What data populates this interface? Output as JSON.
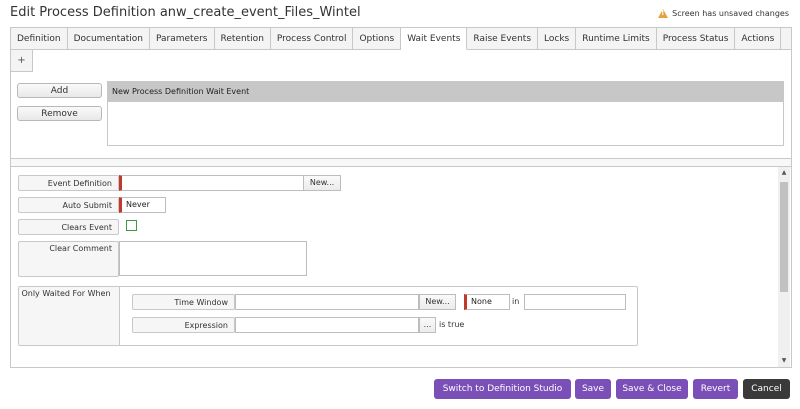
{
  "header": {
    "title": "Edit Process Definition anw_create_event_Files_Wintel",
    "unsaved_text": "Screen has unsaved changes",
    "warning_icon": "warning-triangle-icon",
    "warning_color": "#e6a23c"
  },
  "tabs": [
    {
      "label": "Definition"
    },
    {
      "label": "Documentation"
    },
    {
      "label": "Parameters"
    },
    {
      "label": "Retention"
    },
    {
      "label": "Process Control"
    },
    {
      "label": "Options"
    },
    {
      "label": "Wait Events",
      "active": true
    },
    {
      "label": "Raise Events"
    },
    {
      "label": "Locks"
    },
    {
      "label": "Runtime Limits"
    },
    {
      "label": "Process Status"
    },
    {
      "label": "Actions"
    }
  ],
  "add_tab_label": "+",
  "events_list": {
    "add_label": "Add",
    "remove_label": "Remove",
    "items": [
      "New Process Definition Wait Event"
    ]
  },
  "form": {
    "event_definition_label": "Event Definition",
    "event_definition_value": "",
    "new_button": "New...",
    "auto_submit_label": "Auto Submit",
    "auto_submit_value": "Never",
    "clears_event_label": "Clears Event",
    "clear_comment_label": "Clear Comment",
    "only_waited_label": "Only Waited For When",
    "time_window_label": "Time Window",
    "time_window_value": "",
    "time_window_new": "New...",
    "time_zone_value": "None",
    "in_label": "in",
    "in_value": "",
    "expression_label": "Expression",
    "expression_value": "",
    "expression_btn": "...",
    "is_true_label": "is true"
  },
  "footer": {
    "switch_label": "Switch to Definition Studio",
    "save_label": "Save",
    "save_close_label": "Save & Close",
    "revert_label": "Revert",
    "cancel_label": "Cancel",
    "accent_color": "#7b4fb8",
    "cancel_color": "#3a3a3a"
  }
}
